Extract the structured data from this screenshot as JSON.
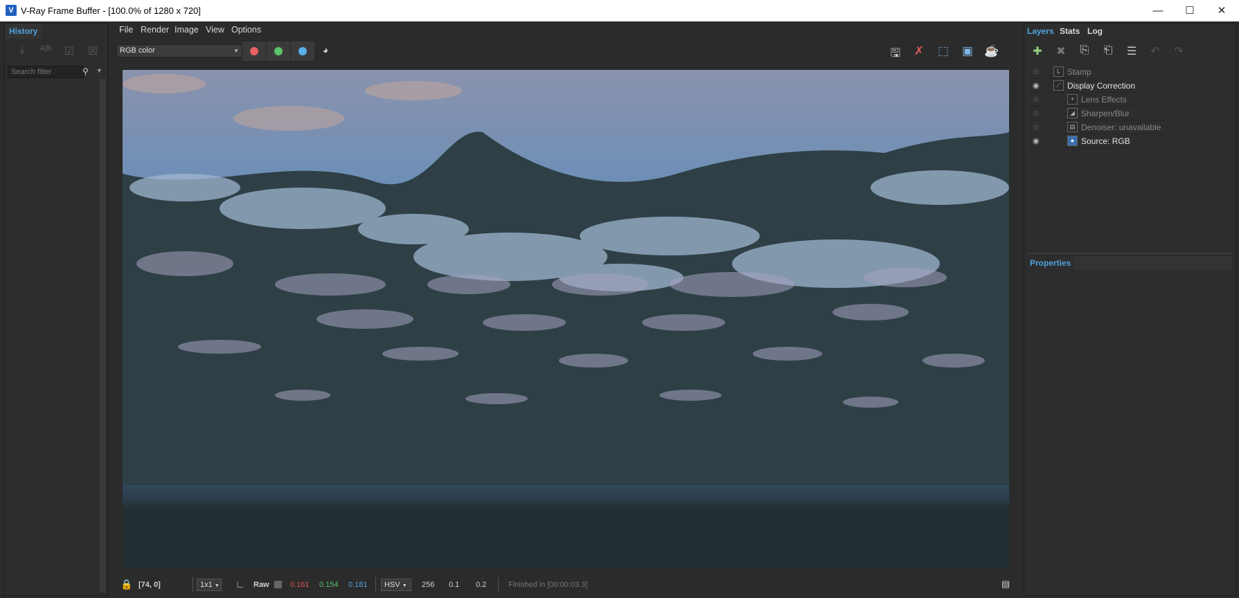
{
  "window": {
    "title": "V-Ray Frame Buffer - [100.0% of 1280 x 720]",
    "icon": "vray-logo-icon",
    "minimize": "—",
    "maximize": "☐",
    "close": "✕"
  },
  "history": {
    "tab": "History",
    "search_placeholder": "Search filter"
  },
  "menu": [
    "File",
    "Render",
    "Image",
    "View",
    "Options"
  ],
  "toolbar": {
    "channel_select": "RGB color",
    "channels": [
      {
        "name": "red-channel",
        "color": "#e86060"
      },
      {
        "name": "green-channel",
        "color": "#5cc46a"
      },
      {
        "name": "blue-channel",
        "color": "#5ab0e8"
      }
    ]
  },
  "status": {
    "coords": "[74, 0]",
    "sampling": "1x1",
    "raw_label": "Raw",
    "r": "0.161",
    "g": "0.154",
    "b": "0.181",
    "color_mode": "HSV",
    "h": "256",
    "s": "0.1",
    "v": "0.2",
    "message": "Finished in [00:00:03.3]",
    "colors": {
      "r": "#e05050",
      "g": "#55c46a",
      "b": "#4fa3df"
    }
  },
  "right": {
    "tabs": [
      "Layers",
      "Stats",
      "Log"
    ],
    "layers": [
      {
        "name": "Stamp",
        "visible": false,
        "indent": 0
      },
      {
        "name": "Display Correction",
        "visible": true,
        "indent": 0
      },
      {
        "name": "Lens Effects",
        "visible": false,
        "indent": 1
      },
      {
        "name": "Sharpen/Blur",
        "visible": false,
        "indent": 1
      },
      {
        "name": "Denoiser: unavailable",
        "visible": false,
        "indent": 1
      },
      {
        "name": "Source: RGB",
        "visible": true,
        "indent": 1
      }
    ],
    "properties_label": "Properties"
  },
  "accent": "#4fa3df"
}
